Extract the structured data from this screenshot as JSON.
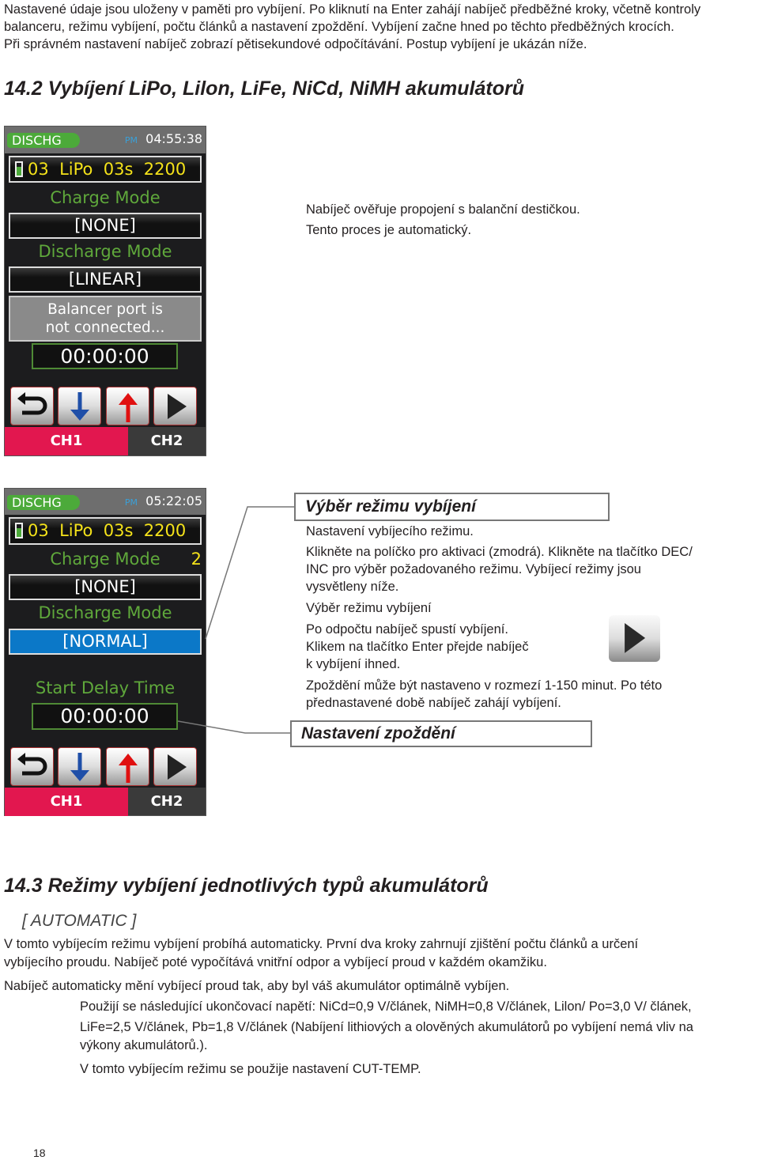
{
  "intro": [
    "Nastavené údaje jsou uloženy v paměti pro vybíjení. Po kliknutí na Enter zahájí nabíječ předběžné kroky, včetně kontroly",
    "balanceru, režimu vybíjení, počtu článků a nastavení zpoždění. Vybíjení začne hned po těchto předběžných krocích.",
    "Při správném nastavení nabíječ zobrazí pětisekundové odpočítávání. Postup vybíjení je ukázán níže."
  ],
  "section1": {
    "title": "14.2 Vybíjení LiPo, Lilon, LiFe, NiCd, NiMH akumulátorů"
  },
  "screen1": {
    "status": "DISCHG",
    "ampm": "PM",
    "clock": "04:55:38",
    "battery_row": "03  LiPo  03s  2200",
    "charge_label": "Charge Mode",
    "charge_value": "[NONE]",
    "discharge_label": "Discharge Mode",
    "discharge_value": "[LINEAR]",
    "message": [
      "Balancer port is",
      "not connected..."
    ],
    "timer": "00:00:00",
    "ch1": "CH1",
    "ch2": "CH2"
  },
  "screen1_note": [
    "Nabíječ ověřuje propojení s balanční destičkou.",
    "Tento proces je automatický."
  ],
  "screen2": {
    "status": "DISCHG",
    "ampm": "PM",
    "clock": "05:22:05",
    "battery_row": "03  LiPo  03s  2200",
    "charge_label": "Charge Mode",
    "charge_index": "2",
    "charge_value": "[NONE]",
    "discharge_label": "Discharge Mode",
    "discharge_value": "[NORMAL]",
    "delay_label": "Start Delay Time",
    "timer": "00:00:00",
    "ch1": "CH1",
    "ch2": "CH2"
  },
  "callout1": {
    "title": "Výběr režimu vybíjení",
    "lines": [
      "Nastavení vybíjecího režimu.",
      "Klikněte na políčko pro aktivaci (zmodrá). Klikněte na tlačítko DEC/",
      "INC pro výběr požadovaného režimu. Vybíjecí režimy jsou",
      "vysvětleny níže.",
      "Výběr režimu vybíjení",
      "Po odpočtu nabíječ spustí vybíjení.",
      "Klikem na tlačítko Enter přejde nabíječ",
      "k vybíjení ihned.",
      "Zpoždění může být nastaveno v rozmezí 1-150 minut. Po této",
      "přednastavené době nabíječ zahájí vybíjení."
    ]
  },
  "callout2": {
    "title": "Nastavení zpoždění"
  },
  "section2": {
    "title": "14.3 Režimy vybíjení jednotlivých typů akumulátorů",
    "subtitle": "[ AUTOMATIC ]",
    "lines": [
      "V tomto vybíjecím režimu vybíjení probíhá automaticky. První dva kroky zahrnují zjištění počtu článků a určení",
      "vybíjecího proudu. Nabíječ poté vypočítává vnitřní odpor a vybíjecí proud v každém okamžiku.",
      "Nabíječ automaticky mění vybíjecí proud tak, aby byl váš akumulátor optimálně vybíjen."
    ],
    "indented": [
      "Použijí se následující ukončovací napětí: NiCd=0,9 V/článek, NiMH=0,8 V/článek, Lilon/ Po=3,0 V/ článek,",
      "LiFe=2,5 V/článek, Pb=1,8 V/článek (Nabíjení lithiových a olověných akumulátorů po vybíjení nemá vliv na",
      "výkony akumulátorů.).",
      "V tomto vybíjecím režimu se použije nastavení CUT-TEMP."
    ]
  },
  "page_number": "18",
  "colors": {
    "status_green": "#4caa3a",
    "ch1_pink": "#e2174f",
    "selected_blue": "#0b78c8",
    "label_green": "#5fa83b",
    "value_yellow": "#f4e21a"
  }
}
